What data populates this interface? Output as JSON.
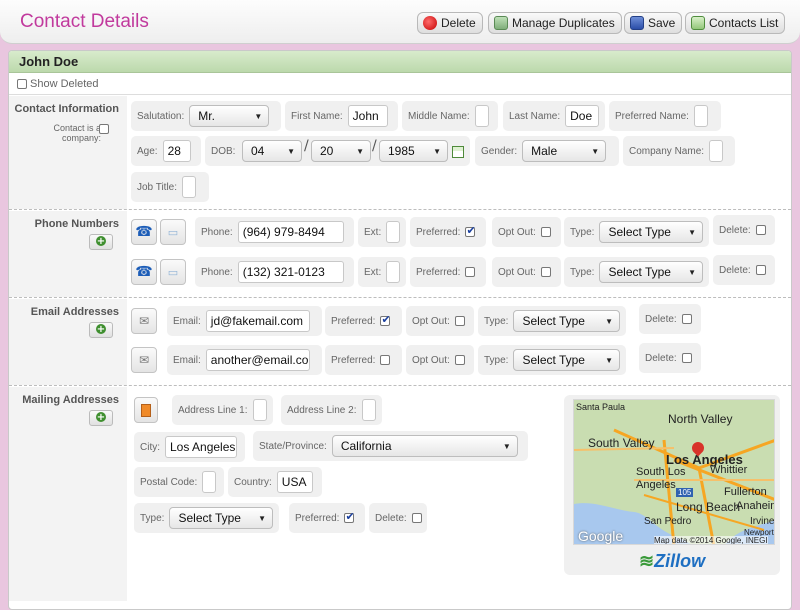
{
  "header": {
    "title": "Contact Details",
    "buttons": {
      "delete": "Delete",
      "manage_duplicates": "Manage Duplicates",
      "save": "Save",
      "contacts_list": "Contacts List"
    }
  },
  "contact_name": "John Doe",
  "show_deleted_label": "Show Deleted",
  "contact_info": {
    "section_title": "Contact Information",
    "is_company_label": "Contact is a company:",
    "salutation_label": "Salutation:",
    "salutation_value": "Mr.",
    "first_name_label": "First Name:",
    "first_name_value": "John",
    "middle_name_label": "Middle Name:",
    "middle_name_value": "",
    "last_name_label": "Last Name:",
    "last_name_value": "Doe",
    "preferred_name_label": "Preferred Name:",
    "preferred_name_value": "",
    "age_label": "Age:",
    "age_value": "28",
    "dob_label": "DOB:",
    "dob_month": "04",
    "dob_day": "20",
    "dob_year": "1985",
    "gender_label": "Gender:",
    "gender_value": "Male",
    "company_name_label": "Company Name:",
    "company_name_value": "",
    "job_title_label": "Job Title:",
    "job_title_value": ""
  },
  "phones": {
    "section_title": "Phone Numbers",
    "rows": [
      {
        "phone_label": "Phone:",
        "phone_value": "(964) 979-8494",
        "ext_label": "Ext:",
        "preferred_label": "Preferred:",
        "preferred": true,
        "opt_out_label": "Opt Out:",
        "opt_out": false,
        "type_label": "Type:",
        "type_value": "Select Type",
        "delete_label": "Delete:",
        "delete": false
      },
      {
        "phone_label": "Phone:",
        "phone_value": "(132) 321-0123",
        "ext_label": "Ext:",
        "preferred_label": "Preferred:",
        "preferred": false,
        "opt_out_label": "Opt Out:",
        "opt_out": false,
        "type_label": "Type:",
        "type_value": "Select Type",
        "delete_label": "Delete:",
        "delete": false
      }
    ]
  },
  "emails": {
    "section_title": "Email Addresses",
    "rows": [
      {
        "email_label": "Email:",
        "email_value": "jd@fakemail.com",
        "preferred_label": "Preferred:",
        "preferred": true,
        "opt_out_label": "Opt Out:",
        "opt_out": false,
        "type_label": "Type:",
        "type_value": "Select Type",
        "delete_label": "Delete:",
        "delete": false
      },
      {
        "email_label": "Email:",
        "email_value": "another@email.com",
        "preferred_label": "Preferred:",
        "preferred": false,
        "opt_out_label": "Opt Out:",
        "opt_out": false,
        "type_label": "Type:",
        "type_value": "Select Type",
        "delete_label": "Delete:",
        "delete": false
      }
    ]
  },
  "mailing": {
    "section_title": "Mailing Addresses",
    "address1_label": "Address Line 1:",
    "address2_label": "Address Line 2:",
    "city_label": "City:",
    "city_value": "Los Angeles",
    "state_label": "State/Province:",
    "state_value": "California",
    "postal_label": "Postal Code:",
    "country_label": "Country:",
    "country_value": "USA",
    "type_label": "Type:",
    "type_value": "Select Type",
    "preferred_label": "Preferred:",
    "preferred": true,
    "delete_label": "Delete:",
    "delete": false,
    "map": {
      "labels": [
        "Santa Paula",
        "North Valley",
        "South Valley",
        "Los Angeles",
        "Whittier",
        "South Los Angeles",
        "Fullerton",
        "Anaheim",
        "Long Beach",
        "San Pedro",
        "Irvine",
        "Newport"
      ],
      "attribution": "Map data ©2014 Google, INEGI",
      "google": "Google",
      "route_number": "105",
      "brand": "Zillow"
    }
  }
}
